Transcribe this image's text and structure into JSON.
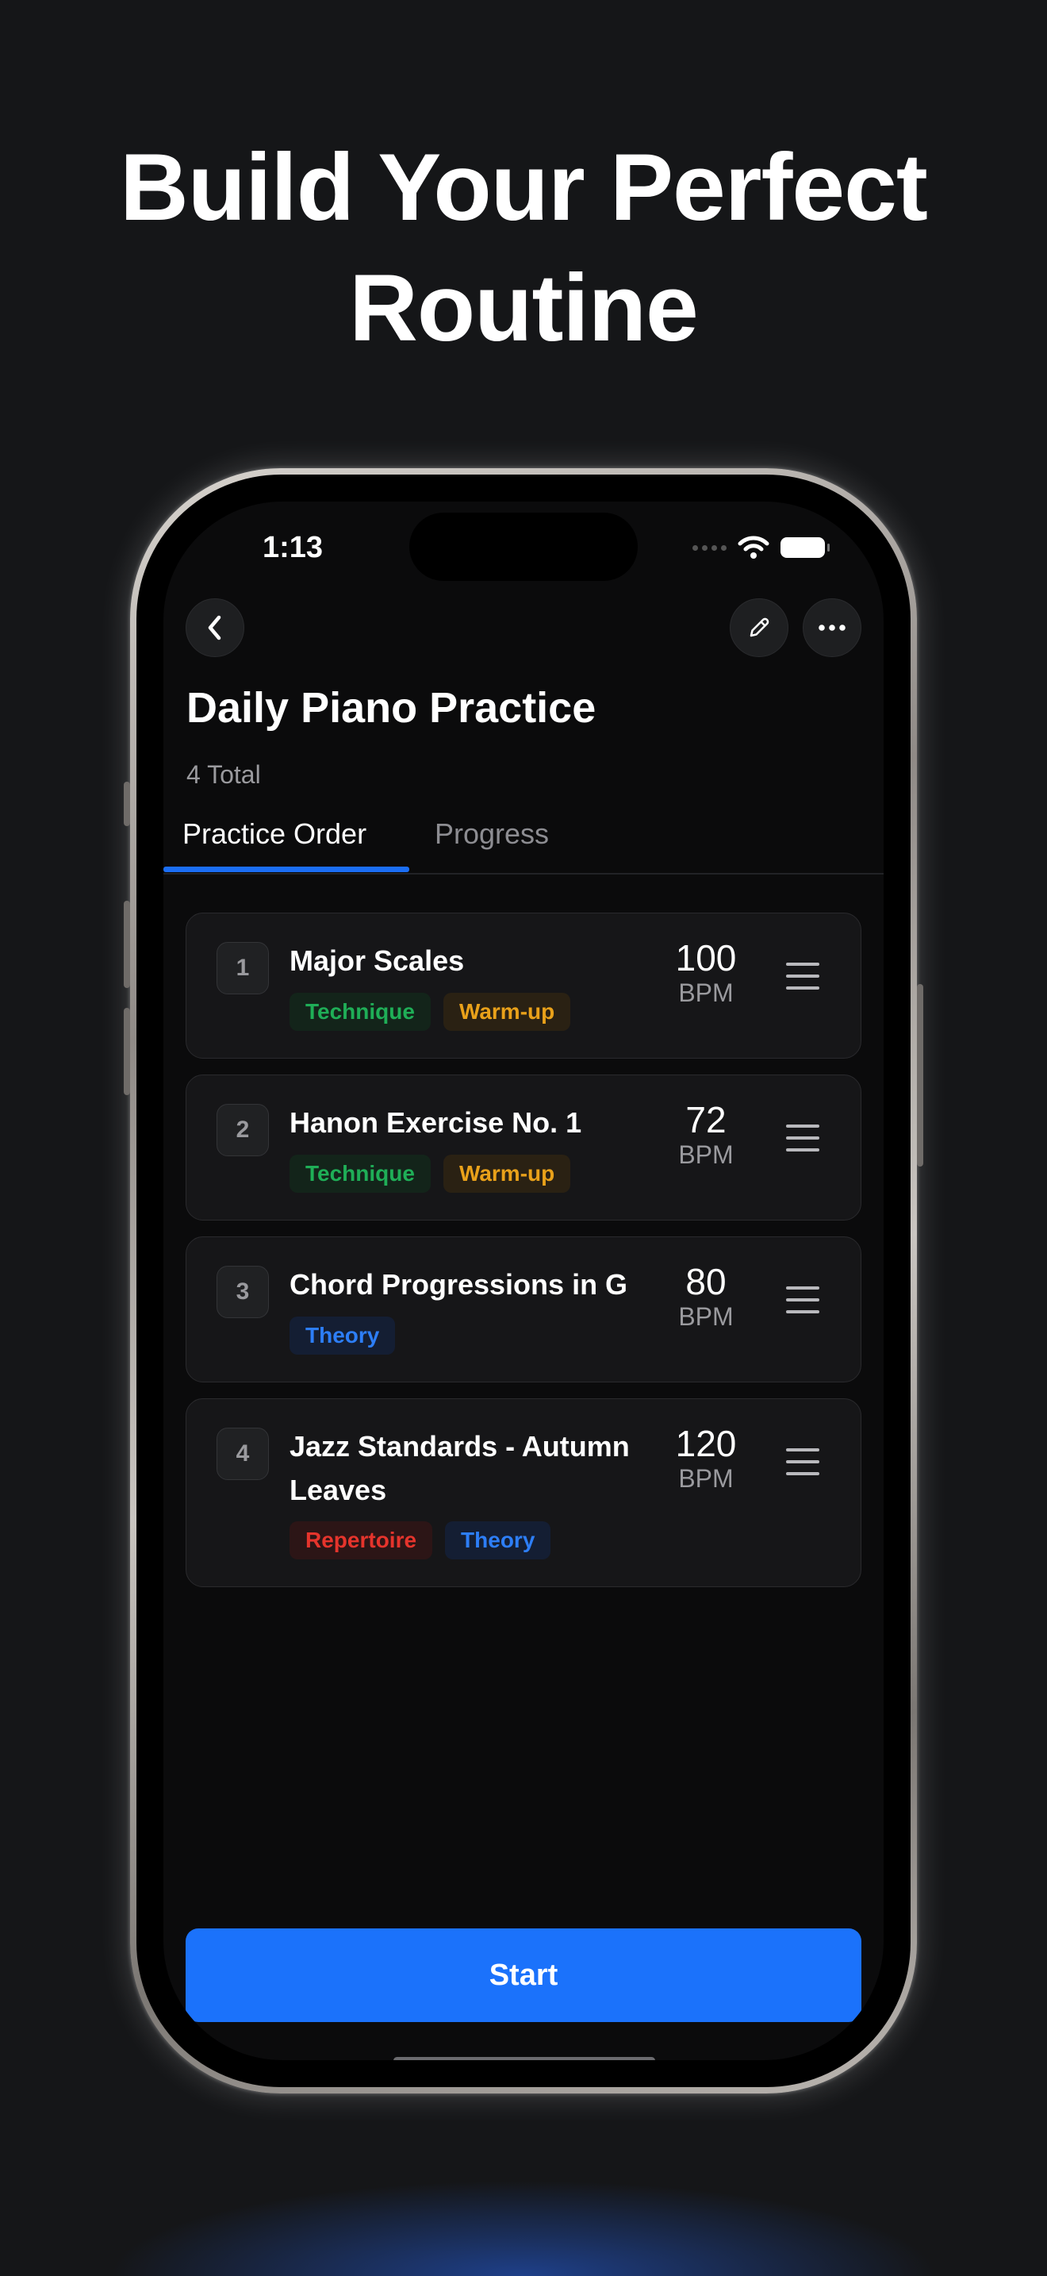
{
  "headline": {
    "line1": "Build Your Perfect",
    "line2": "Routine"
  },
  "status_bar": {
    "time": "1:13"
  },
  "header": {
    "title": "Daily Piano Practice",
    "subtitle": "4 Total"
  },
  "tabs": [
    {
      "label": "Practice Order",
      "active": true
    },
    {
      "label": "Progress",
      "active": false
    }
  ],
  "items": [
    {
      "number": "1",
      "name": "Major Scales",
      "bpm": "100",
      "bpm_unit": "BPM",
      "tags": [
        {
          "label": "Technique",
          "color": "green"
        },
        {
          "label": "Warm-up",
          "color": "orange"
        }
      ]
    },
    {
      "number": "2",
      "name": "Hanon Exercise No. 1",
      "bpm": "72",
      "bpm_unit": "BPM",
      "tags": [
        {
          "label": "Technique",
          "color": "green"
        },
        {
          "label": "Warm-up",
          "color": "orange"
        }
      ]
    },
    {
      "number": "3",
      "name": "Chord Progressions in G",
      "bpm": "80",
      "bpm_unit": "BPM",
      "tags": [
        {
          "label": "Theory",
          "color": "blue"
        }
      ]
    },
    {
      "number": "4",
      "name": "Jazz Standards - Autumn Leaves",
      "bpm": "120",
      "bpm_unit": "BPM",
      "tags": [
        {
          "label": "Repertoire",
          "color": "red"
        },
        {
          "label": "Theory",
          "color": "blue"
        }
      ]
    }
  ],
  "actions": {
    "start_label": "Start"
  },
  "colors": {
    "accent": "#1b72fb",
    "background": "#0b0b0c",
    "tag_green": "#1fae57",
    "tag_orange": "#e9a11a",
    "tag_blue": "#2d7ef7",
    "tag_red": "#e5342c"
  },
  "icons": [
    "chevron-left-icon",
    "pencil-icon",
    "more-horizontal-icon",
    "drag-handle-icon",
    "wifi-icon",
    "battery-icon"
  ]
}
